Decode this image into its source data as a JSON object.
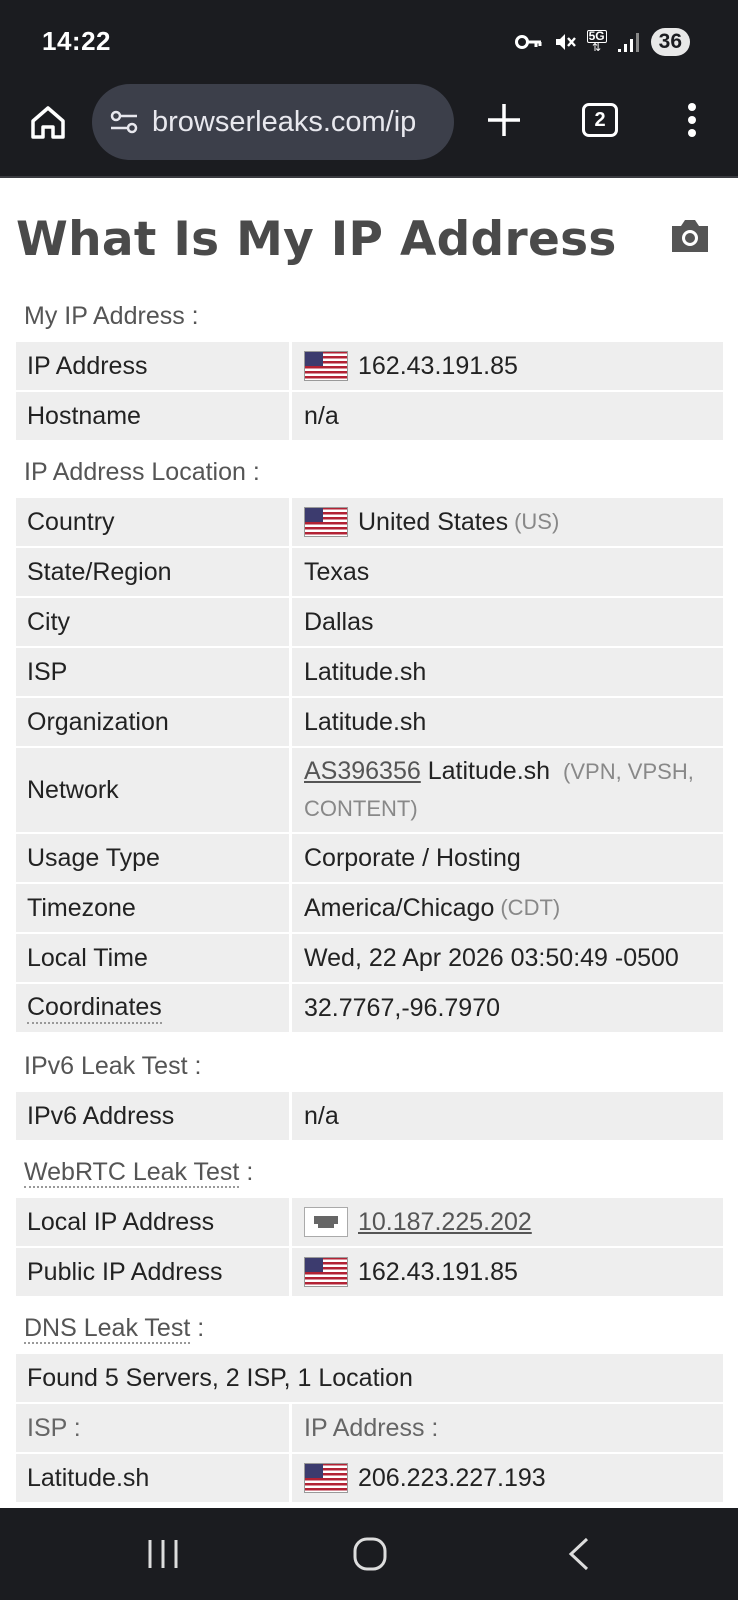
{
  "status_bar": {
    "time": "14:22",
    "network": "5G",
    "battery": "36"
  },
  "browser": {
    "url": "browserleaks.com/ip",
    "tab_count": "2"
  },
  "page": {
    "title": "What Is My IP Address"
  },
  "sections": {
    "my_ip": "My IP Address :",
    "location": "IP Address Location :",
    "ipv6": "IPv6 Leak Test :",
    "webrtc": "WebRTC Leak Test",
    "dns": "DNS Leak Test"
  },
  "colon": ":",
  "rows": {
    "ip_address": {
      "label": "IP Address",
      "value": "162.43.191.85"
    },
    "hostname": {
      "label": "Hostname",
      "value": "n/a"
    },
    "country": {
      "label": "Country",
      "value": "United States",
      "sub": "(US)"
    },
    "state": {
      "label": "State/Region",
      "value": "Texas"
    },
    "city": {
      "label": "City",
      "value": "Dallas"
    },
    "isp": {
      "label": "ISP",
      "value": "Latitude.sh"
    },
    "organization": {
      "label": "Organization",
      "value": "Latitude.sh"
    },
    "network": {
      "label": "Network",
      "asn": "AS396356",
      "value": "Latitude.sh",
      "sub": "(VPN, VPSH, CONTENT)"
    },
    "usage_type": {
      "label": "Usage Type",
      "value": "Corporate / Hosting"
    },
    "timezone": {
      "label": "Timezone",
      "value": "America/Chicago",
      "sub": "(CDT)"
    },
    "local_time": {
      "label": "Local Time",
      "value": "Wed, 22 Apr 2026 03:50:49 -0500"
    },
    "coordinates": {
      "label": "Coordinates",
      "value": "32.7767,-96.7970"
    },
    "ipv6_address": {
      "label": "IPv6 Address",
      "value": "n/a"
    },
    "local_ip": {
      "label": "Local IP Address",
      "value": "10.187.225.202"
    },
    "public_ip": {
      "label": "Public IP Address",
      "value": "162.43.191.85"
    }
  },
  "dns": {
    "summary": "Found 5 Servers, 2 ISP, 1 Location",
    "col_isp": "ISP :",
    "col_ip": "IP Address :",
    "first_isp": "Latitude.sh",
    "first_ip": "206.223.227.193"
  }
}
